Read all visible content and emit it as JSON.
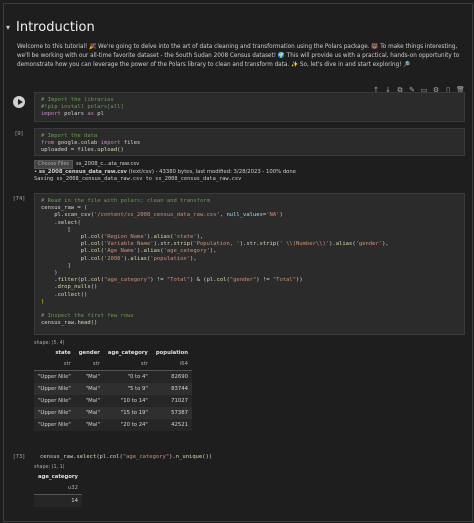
{
  "heading": {
    "title": "Introduction"
  },
  "intro": {
    "text": "Welcome to this tutorial! 🎉 We're going to delve into the art of data cleaning and transformation using the Polars package. 🐻 To make things interesting, we'll be working with our all-time favorite dataset - the South Sudan 2008 Census dataset! 🌍 This will provide us with a practical, hands-on opportunity to demonstrate how you can leverage the power of the Polars library to clean and transform data. ✨ So, let's dive in and start exploring! 🔎"
  },
  "toolbar": {
    "icons": [
      "↑",
      "↓",
      "⧉",
      "✎",
      "▭",
      "⚙",
      "▯",
      "🗑"
    ]
  },
  "cells": {
    "c1": {
      "label": ""
    },
    "c2": {
      "label": "[9]"
    },
    "c3": {
      "label": "[74]"
    },
    "c4": {
      "label": "[73]"
    }
  },
  "upload": {
    "button": "Choose Files",
    "filename": "ss_2008_c...ata_raw.csv",
    "file_line_bold": "ss_2008_census_data_raw.csv",
    "file_line_rest": "(text/csv) - 43380 bytes, last modified: 3/28/2023 - 100% done",
    "saving": "Saving ss_2008_census_data_raw.csv to ss_2008_census_data_raw.csv"
  },
  "table1": {
    "shape": "shape: (5, 4)",
    "columns": [
      "state",
      "gender",
      "age_category",
      "population"
    ],
    "dtypes": [
      "str",
      "str",
      "str",
      "i64"
    ],
    "rows": [
      [
        "\"Upper Nile\"",
        "\"Mal\"",
        "\"0 to 4\"",
        "82690"
      ],
      [
        "\"Upper Nile\"",
        "\"Mal\"",
        "\"5 to 9\"",
        "83744"
      ],
      [
        "\"Upper Nile\"",
        "\"Mal\"",
        "\"10 to 14\"",
        "71027"
      ],
      [
        "\"Upper Nile\"",
        "\"Mal\"",
        "\"15 to 19\"",
        "57387"
      ],
      [
        "\"Upper Nile\"",
        "\"Mal\"",
        "\"20 to 24\"",
        "42521"
      ]
    ]
  },
  "table2": {
    "shape": "shape: (1, 1)",
    "columns": [
      "age_category"
    ],
    "dtypes": [
      "u32"
    ],
    "rows": [
      [
        "14"
      ]
    ]
  }
}
